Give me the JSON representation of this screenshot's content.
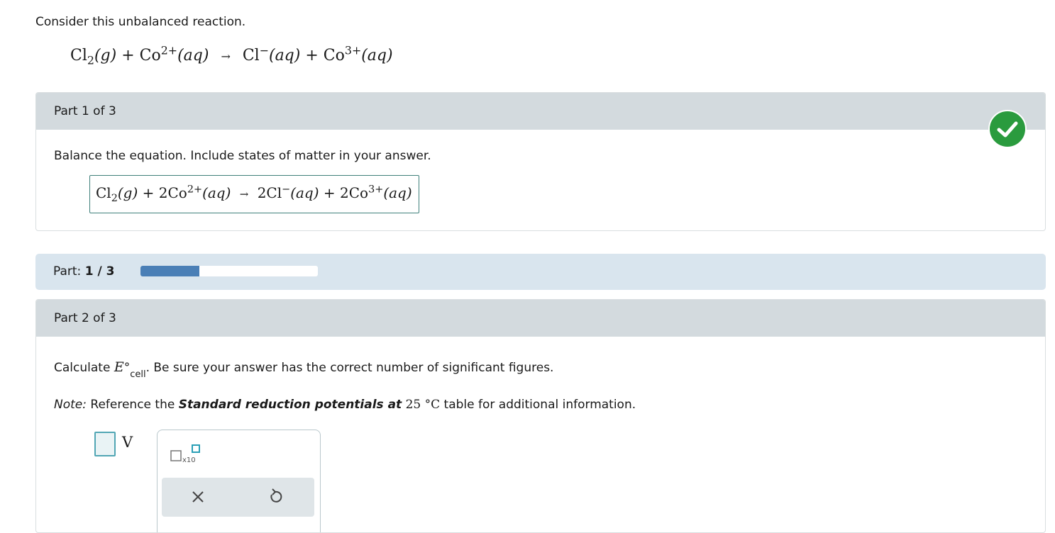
{
  "intro": "Consider this unbalanced reaction.",
  "reaction": {
    "r1": "Cl",
    "r1_sub": "2",
    "r1_state": "(g)",
    "plus": "+",
    "r2": "Co",
    "r2_charge": "2+",
    "r2_state": "(aq)",
    "arrow": "→",
    "p1": "Cl",
    "p1_charge": "−",
    "p1_state": "(aq)",
    "p2": "Co",
    "p2_charge": "3+",
    "p2_state": "(aq)"
  },
  "part1": {
    "header": "Part 1 of 3",
    "instruction": "Balance the equation. Include states of matter in your answer.",
    "answer": {
      "r1": "Cl",
      "r1_sub": "2",
      "r1_state": "(g)",
      "plus": "+",
      "r2": "2Co",
      "r2_charge": "2+",
      "r2_state": "(aq)",
      "arrow": "→",
      "p1": "2Cl",
      "p1_charge": "−",
      "p1_state": "(aq)",
      "p2": "2Co",
      "p2_charge": "3+",
      "p2_state": "(aq)"
    },
    "status_icon": "checkmark-icon",
    "status_color": "#2a9b3e"
  },
  "progress": {
    "label": "Part:",
    "value": "1 / 3",
    "fraction": 0.333,
    "bar_color": "#4a7fb6"
  },
  "part2": {
    "header": "Part 2 of 3",
    "calc_prefix": "Calculate",
    "calc_symbol": "E",
    "calc_degree": "°",
    "calc_sub": "cell",
    "calc_suffix": ". Be sure your answer has the correct number of significant figures.",
    "note_label": "Note:",
    "note_pre": "Reference the",
    "note_bold": "Standard reduction potentials at",
    "note_temp": "25 °C",
    "note_post": "table for additional information.",
    "unit": "V",
    "sci_label": "x10",
    "icons": [
      "clear-icon",
      "reset-icon"
    ]
  }
}
